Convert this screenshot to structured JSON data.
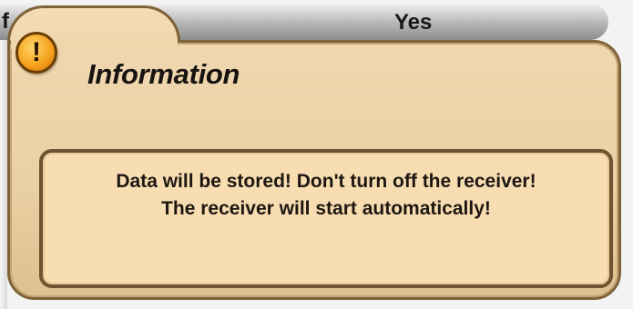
{
  "background_menu": {
    "left_fragment": "f",
    "value": "Yes"
  },
  "dialog": {
    "icon": "exclamation-warning-icon",
    "icon_glyph": "!",
    "title": "Information",
    "message_lines": [
      "Data will be stored! Don't turn off the receiver!",
      "The receiver will start automatically!"
    ]
  },
  "colors": {
    "dialog_background": "#ead0a3",
    "dialog_border": "#7f6236",
    "message_background": "#f7ddb1",
    "warning_icon": "#f6a11b"
  }
}
